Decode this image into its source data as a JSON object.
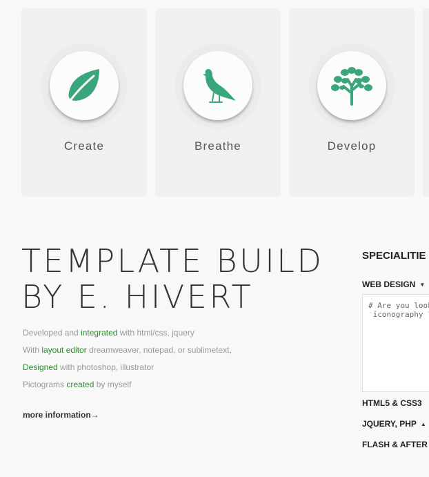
{
  "features": [
    {
      "label": "Create",
      "icon": "leaf-icon"
    },
    {
      "label": "Breathe",
      "icon": "bird-icon"
    },
    {
      "label": "Develop",
      "icon": "tree-icon"
    }
  ],
  "colors": {
    "accent": "#3aa67c",
    "link_green": "#2f8a2f",
    "heading": "#333333",
    "muted": "#999999"
  },
  "intro": {
    "headline_line1": "TEMPLATE BUILD",
    "headline_line2": "BY E. HIVERT",
    "lines": [
      {
        "before": "Developed and ",
        "highlight": "integrated",
        "after": " with html/css, jquery"
      },
      {
        "before": "With ",
        "highlight": "layout editor",
        "after": " dreamweaver, notepad, or sublimetext,"
      },
      {
        "before": "",
        "highlight": "Designed",
        "after": " with photoshop, illustrator"
      },
      {
        "before": "Pictograms ",
        "highlight": "created",
        "after": " by myself"
      }
    ],
    "more_link": "more information",
    "more_arrow": "→"
  },
  "specialities": {
    "title": "SPECIALITIE",
    "items": [
      {
        "label": "WEB DESIGN",
        "caret": "▼"
      },
      {
        "label": "HTML5 & CSS3",
        "caret": ""
      },
      {
        "label": "JQUERY, PHP",
        "caret": "▲"
      },
      {
        "label": "FLASH & AFTER",
        "caret": ""
      }
    ],
    "code_text": "# Are you lookir\n iconography ?"
  }
}
